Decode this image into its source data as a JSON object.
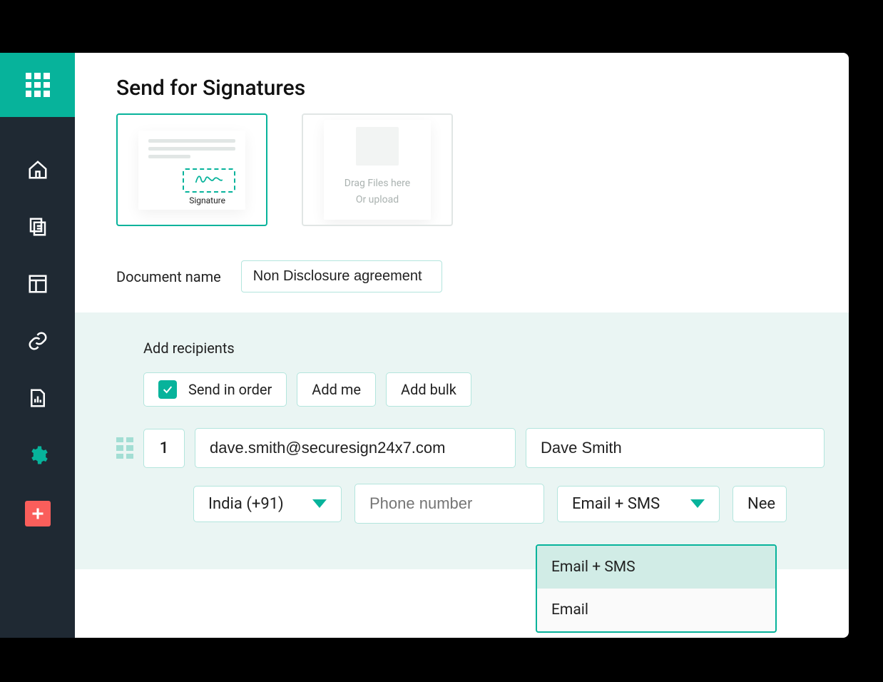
{
  "page": {
    "title": "Send for Signatures"
  },
  "document_card": {
    "signature_label": "Signature"
  },
  "upload_card": {
    "line1": "Drag Files here",
    "line2": "Or upload"
  },
  "document_name": {
    "label": "Document name",
    "value": "Non Disclosure agreement"
  },
  "recipients": {
    "section_title": "Add recipients",
    "buttons": {
      "send_in_order": "Send in order",
      "add_me": "Add me",
      "add_bulk": "Add bulk"
    },
    "row": {
      "index": "1",
      "email": "dave.smith@securesign24x7.com",
      "name": "Dave Smith",
      "country_code": "India (+91)",
      "phone_placeholder": "Phone number",
      "delivery": "Email + SMS",
      "need_label": "Nee"
    }
  },
  "delivery_dropdown": {
    "options": [
      "Email + SMS",
      "Email"
    ]
  }
}
